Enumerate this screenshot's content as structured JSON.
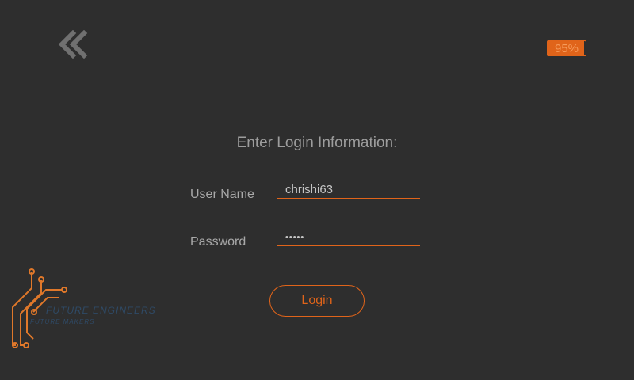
{
  "header": {
    "back_icon": "double-chevron-left-icon",
    "battery": {
      "label": "95%",
      "level": 0.95,
      "color": "#e0641a"
    }
  },
  "form": {
    "title": "Enter Login Information:",
    "username_label": "User Name",
    "username_value": "chrishi63",
    "password_label": "Password",
    "password_value": "•••••",
    "login_label": "Login"
  },
  "logo": {
    "brand": "FUTURE ENGINEERS",
    "tagline": "FUTURE MAKERS",
    "icon": "circuit-traces-icon"
  },
  "colors": {
    "background": "#2e2e2e",
    "accent": "#e0641a",
    "text": "#a9a9a9"
  }
}
